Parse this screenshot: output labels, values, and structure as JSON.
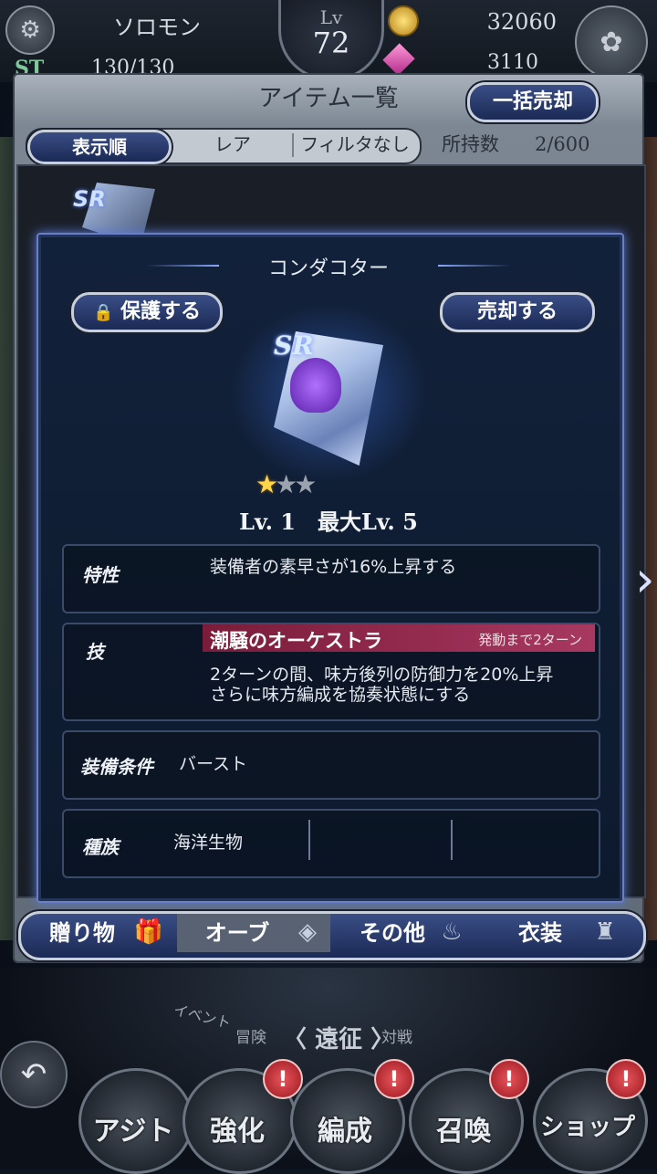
{
  "status": {
    "player_name": "ソロモン",
    "level_label": "Lv",
    "level_value": "72",
    "gold": "32060",
    "st_label": "ST",
    "stamina": "130/130",
    "gems": "3110"
  },
  "panel": {
    "title": "アイテム一覧",
    "bulk_sell_label": "一括売却",
    "sort_label": "表示順",
    "sort_value": "レア",
    "filter_value": "フィルタなし",
    "owned_label": "所持数",
    "owned_value": "2/600"
  },
  "detail": {
    "name": "コンダコター",
    "protect_label": "保護する",
    "sell_label": "売却する",
    "rarity": "SR",
    "stars_filled": 1,
    "stars_total": 3,
    "level_text": "Lv. 1　最大Lv. 5",
    "trait_label": "特性",
    "trait_text": "装備者の素早さが16%上昇する",
    "skill_label": "技",
    "skill_name": "潮騒のオーケストラ",
    "skill_cooldown": "発動まで2ターン",
    "skill_desc_1": "2ターンの間、味方後列の防御力を20%上昇",
    "skill_desc_2": "さらに味方編成を協奏状態にする",
    "equip_label": "装備条件",
    "equip_value": "バースト",
    "race_label": "種族",
    "race_value": "海洋生物"
  },
  "tabs": [
    {
      "label": "贈り物",
      "icon": "gift-icon"
    },
    {
      "label": "オーブ",
      "icon": "orb-icon"
    },
    {
      "label": "その他",
      "icon": "pouch-icon"
    },
    {
      "label": "衣装",
      "icon": "mannequin-icon"
    }
  ],
  "world": {
    "event": "イベント",
    "adventure": "冒険",
    "expedition": "〈 遠征 〉",
    "versus": "対戦"
  },
  "nav": [
    {
      "label": "アジト",
      "badge": ""
    },
    {
      "label": "強化",
      "badge": "!"
    },
    {
      "label": "編成",
      "badge": "!"
    },
    {
      "label": "召喚",
      "badge": "!"
    },
    {
      "label": "ショップ",
      "badge": "!"
    }
  ],
  "colors": {
    "accent": "#3a4e86",
    "skill_bar": "#a83860",
    "star": "#ffd54a"
  }
}
